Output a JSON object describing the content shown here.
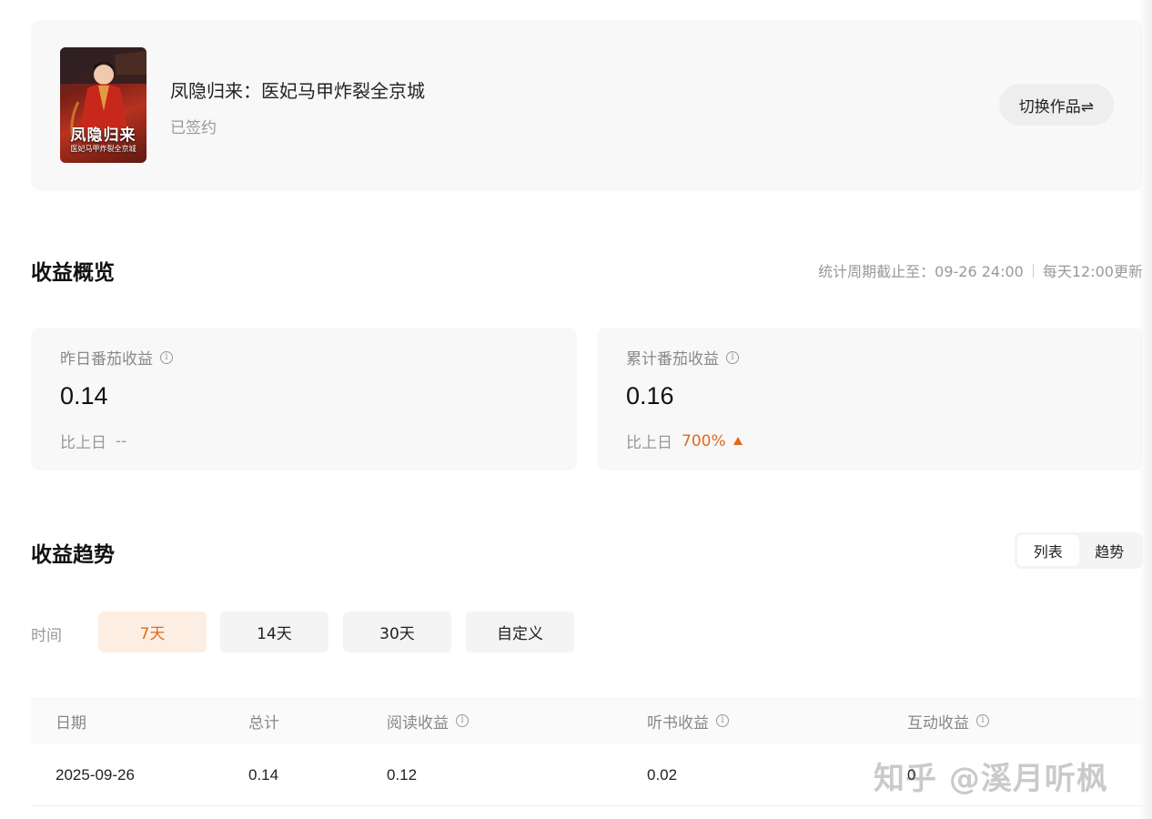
{
  "book": {
    "title": "凤隐归来：医妃马甲炸裂全京城",
    "status": "已签约",
    "cover_title": "凤隐归来",
    "cover_subtitle": "医妃马甲炸裂全京城",
    "switch_label": "切换作品⇌"
  },
  "overview": {
    "title": "收益概览",
    "period_text": "统计周期截止至：09-26 24:00",
    "update_text": "每天12:00更新",
    "cards": [
      {
        "label": "昨日番茄收益",
        "value": "0.14",
        "compare_label": "比上日",
        "compare_value": "--"
      },
      {
        "label": "累计番茄收益",
        "value": "0.16",
        "compare_label": "比上日",
        "compare_value": "700%"
      }
    ]
  },
  "trend": {
    "title": "收益趋势",
    "view_options": [
      "列表",
      "趋势"
    ],
    "selected_view": "列表",
    "time_label": "时间",
    "ranges": [
      "7天",
      "14天",
      "30天",
      "自定义"
    ],
    "selected_range": "7天",
    "columns": [
      "日期",
      "总计",
      "阅读收益",
      "听书收益",
      "互动收益"
    ],
    "rows": [
      [
        "2025-09-26",
        "0.14",
        "0.12",
        "0.02",
        "0"
      ]
    ]
  },
  "watermark": "知乎 @溪月听枫",
  "colors": {
    "accent": "#e06a1e",
    "accent_bg": "#fdeee3",
    "card_bg": "#f8f8f8"
  }
}
